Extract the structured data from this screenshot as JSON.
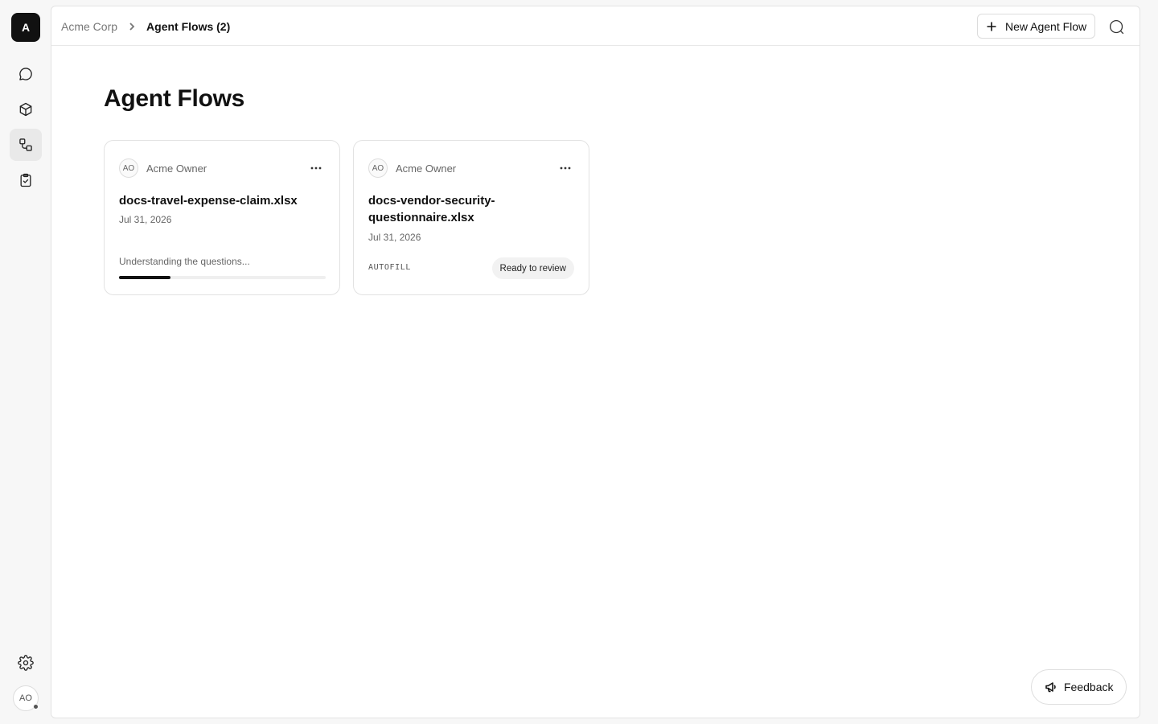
{
  "app": {
    "logo_letter": "A",
    "user_initials": "AO"
  },
  "rail": {
    "items": [
      {
        "name": "chat",
        "icon": "chat-bubble-icon",
        "active": false
      },
      {
        "name": "knowledge",
        "icon": "cube-icon",
        "active": false
      },
      {
        "name": "agent-flows",
        "icon": "flow-icon",
        "active": true
      },
      {
        "name": "tasks",
        "icon": "clipboard-check-icon",
        "active": false
      }
    ],
    "settings_icon": "gear-icon"
  },
  "breadcrumb": {
    "parent": "Acme Corp",
    "current": "Agent Flows (2)"
  },
  "header": {
    "new_button_label": "New Agent Flow",
    "search_icon": "search-icon"
  },
  "page": {
    "title": "Agent Flows"
  },
  "cards": [
    {
      "owner_initials": "AO",
      "owner_name": "Acme Owner",
      "title": "docs-travel-expense-claim.xlsx",
      "date": "Jul 31, 2026",
      "status_text": "Understanding the questions...",
      "progress": 0.25
    },
    {
      "owner_initials": "AO",
      "owner_name": "Acme Owner",
      "title": "docs-vendor-security-questionnaire.xlsx",
      "date": "Jul 31, 2026",
      "tag": "AUTOFILL",
      "status_badge": "Ready to review"
    }
  ],
  "feedback": {
    "label": "Feedback"
  }
}
